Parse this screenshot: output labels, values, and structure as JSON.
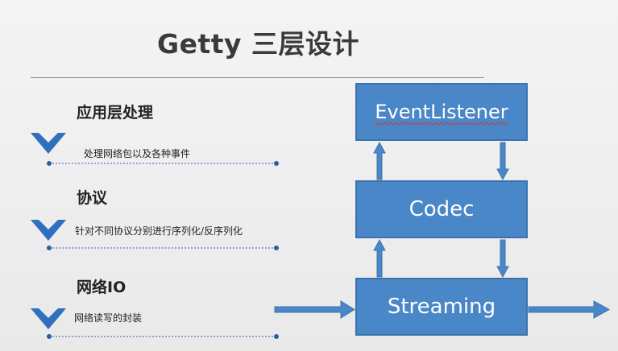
{
  "slide": {
    "title": "Getty 三层设计"
  },
  "layers": [
    {
      "heading": "应用层处理",
      "description": "处理网络包以及各种事件"
    },
    {
      "heading": "协议",
      "description": "针对不同协议分别进行序列化/反序列化"
    },
    {
      "heading": "网络IO",
      "description": "网络读写的封装"
    }
  ],
  "diagram": {
    "boxes": [
      {
        "label": "EventListener"
      },
      {
        "label": "Codec"
      },
      {
        "label": "Streaming"
      }
    ]
  },
  "colors": {
    "box_fill": "#4a87c8",
    "accent_blue": "#2f6fbd",
    "dotted_line": "#2a5da8"
  }
}
